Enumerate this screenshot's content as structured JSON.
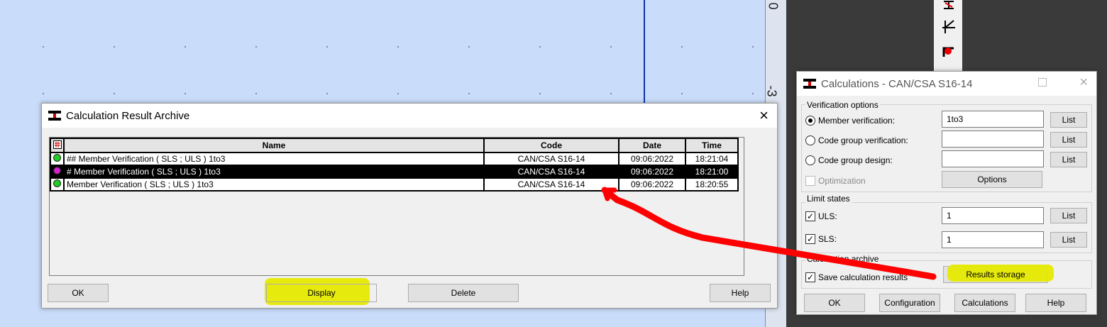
{
  "ruler": {
    "label_top": "0",
    "label_mid": "-3"
  },
  "archive_dialog": {
    "title": "Calculation Result Archive",
    "columns": [
      "Name",
      "Code",
      "Date",
      "Time"
    ],
    "rows": [
      {
        "name": "## Member Verification ( SLS ; ULS ) 1to3",
        "code": "CAN/CSA S16-14",
        "date": "09:06:2022",
        "time": "18:21:04",
        "status_color": "#22cc22",
        "selected": false
      },
      {
        "name": "# Member Verification ( SLS ; ULS ) 1to3",
        "code": "CAN/CSA S16-14",
        "date": "09:06:2022",
        "time": "18:21:00",
        "status_color": "#d020d0",
        "selected": true
      },
      {
        "name": "Member Verification ( SLS ; ULS ) 1to3",
        "code": "CAN/CSA S16-14",
        "date": "09:06:2022",
        "time": "18:20:55",
        "status_color": "#22cc22",
        "selected": false
      }
    ],
    "buttons": {
      "ok": "OK",
      "display": "Display",
      "delete": "Delete",
      "help": "Help"
    },
    "close_icon": "×"
  },
  "calc_dialog": {
    "title": "Calculations - CAN/CSA S16-14",
    "verification_options": {
      "label": "Verification options",
      "member_verification": {
        "label": "Member verification:",
        "value": "1to3",
        "selected": true
      },
      "code_group_verification": {
        "label": "Code group verification:",
        "value": ""
      },
      "code_group_design": {
        "label": "Code group design:",
        "value": ""
      },
      "optimization": {
        "label": "Optimization",
        "checked": false,
        "disabled": true
      },
      "list_button": "List",
      "options_button": "Options"
    },
    "limit_states": {
      "label": "Limit states",
      "uls": {
        "label": "ULS:",
        "value": "1",
        "checked": true
      },
      "sls": {
        "label": "SLS:",
        "value": "1",
        "checked": true
      },
      "list_button": "List"
    },
    "calculation_archive": {
      "label": "Calculation archive",
      "save_results": {
        "label": "Save calculation results",
        "checked": true
      },
      "results_storage_button": "Results storage"
    },
    "buttons": {
      "ok": "OK",
      "configuration": "Configuration",
      "calculations": "Calculations",
      "help": "Help"
    }
  },
  "colors": {
    "highlight": "#e6ea00",
    "arrow": "#ff0000",
    "canvas": "#c9dcfa"
  }
}
